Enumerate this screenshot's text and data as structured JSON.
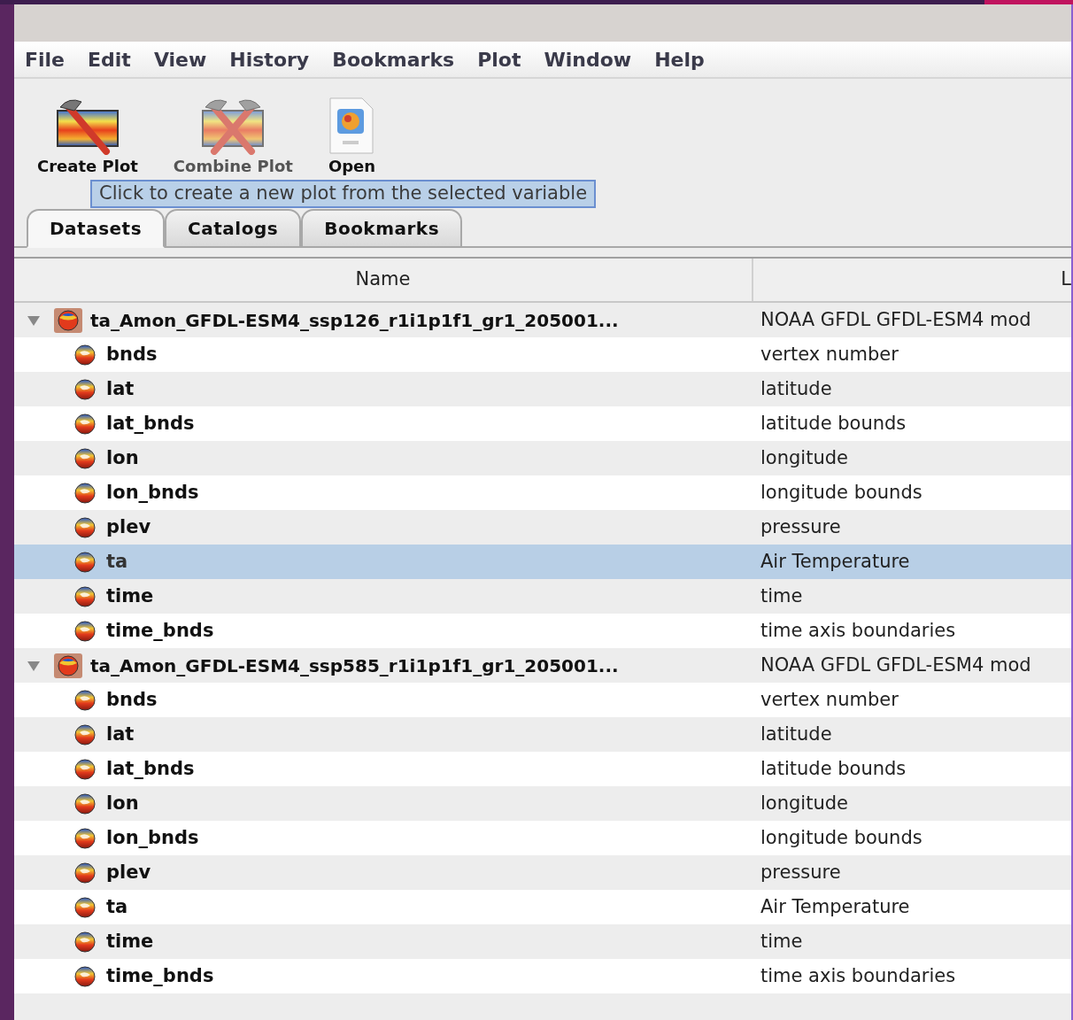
{
  "menu": [
    "File",
    "Edit",
    "View",
    "History",
    "Bookmarks",
    "Plot",
    "Window",
    "Help"
  ],
  "toolbar": [
    {
      "label": "Create Plot",
      "kind": "create"
    },
    {
      "label": "Combine Plot",
      "kind": "combine"
    },
    {
      "label": "Open",
      "kind": "open"
    }
  ],
  "tooltip": "Click to create a new plot from the selected variable",
  "tabs": [
    {
      "label": "Datasets",
      "selected": true
    },
    {
      "label": "Catalogs",
      "selected": false
    },
    {
      "label": "Bookmarks",
      "selected": false
    }
  ],
  "table": {
    "columns": [
      "Name",
      "L"
    ],
    "rows": [
      {
        "name": "ta_Amon_GFDL-ESM4_ssp126_r1i1p1f1_gr1_205001...",
        "column_2": "NOAA GFDL GFDL-ESM4 mod",
        "kind": "dataset",
        "expanded": true,
        "selected": false,
        "children": [
          {
            "name": "bnds",
            "column_2": "vertex number",
            "kind": "variable",
            "selected": false
          },
          {
            "name": "lat",
            "column_2": "latitude",
            "kind": "variable",
            "selected": false
          },
          {
            "name": "lat_bnds",
            "column_2": "latitude bounds",
            "kind": "variable",
            "selected": false
          },
          {
            "name": "lon",
            "column_2": "longitude",
            "kind": "variable",
            "selected": false
          },
          {
            "name": "lon_bnds",
            "column_2": "longitude bounds",
            "kind": "variable",
            "selected": false
          },
          {
            "name": "plev",
            "column_2": "pressure",
            "kind": "variable",
            "selected": false
          },
          {
            "name": "ta",
            "column_2": "Air Temperature",
            "kind": "variable",
            "selected": true
          },
          {
            "name": "time",
            "column_2": "time",
            "kind": "variable",
            "selected": false
          },
          {
            "name": "time_bnds",
            "column_2": "time axis boundaries",
            "kind": "variable",
            "selected": false
          }
        ]
      },
      {
        "name": "ta_Amon_GFDL-ESM4_ssp585_r1i1p1f1_gr1_205001...",
        "column_2": "NOAA GFDL GFDL-ESM4 mod",
        "kind": "dataset",
        "expanded": true,
        "selected": false,
        "children": [
          {
            "name": "bnds",
            "column_2": "vertex number",
            "kind": "variable",
            "selected": false
          },
          {
            "name": "lat",
            "column_2": "latitude",
            "kind": "variable",
            "selected": false
          },
          {
            "name": "lat_bnds",
            "column_2": "latitude bounds",
            "kind": "variable",
            "selected": false
          },
          {
            "name": "lon",
            "column_2": "longitude",
            "kind": "variable",
            "selected": false
          },
          {
            "name": "lon_bnds",
            "column_2": "longitude bounds",
            "kind": "variable",
            "selected": false
          },
          {
            "name": "plev",
            "column_2": "pressure",
            "kind": "variable",
            "selected": false
          },
          {
            "name": "ta",
            "column_2": "Air Temperature",
            "kind": "variable",
            "selected": false
          },
          {
            "name": "time",
            "column_2": "time",
            "kind": "variable",
            "selected": false
          },
          {
            "name": "time_bnds",
            "column_2": "time axis boundaries",
            "kind": "variable",
            "selected": false
          }
        ]
      }
    ]
  }
}
